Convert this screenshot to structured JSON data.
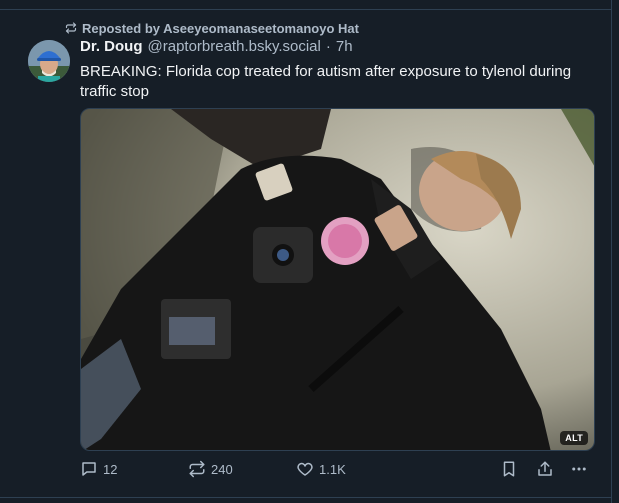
{
  "repost": {
    "label": "Reposted by Aseeyeomanaseetomanoyo Hat"
  },
  "post": {
    "author_name": "Dr. Doug",
    "handle": "@raptorbreath.bsky.social",
    "separator": "·",
    "time": "7h",
    "text": "BREAKING: Florida cop treated for autism after exposure to tylenol during traffic stop",
    "image_alt_badge": "ALT"
  },
  "actions": {
    "replies": "12",
    "reposts": "240",
    "likes": "1.1K"
  },
  "icons": {
    "repost": "repost-icon",
    "reply": "speech-bubble-icon",
    "like": "heart-icon",
    "bookmark": "bookmark-icon",
    "share": "share-icon",
    "more": "ellipsis-icon"
  },
  "colors": {
    "background": "#161e27",
    "text": "#f1f3f5",
    "muted": "#aebbc9",
    "border": "#2e4052"
  }
}
